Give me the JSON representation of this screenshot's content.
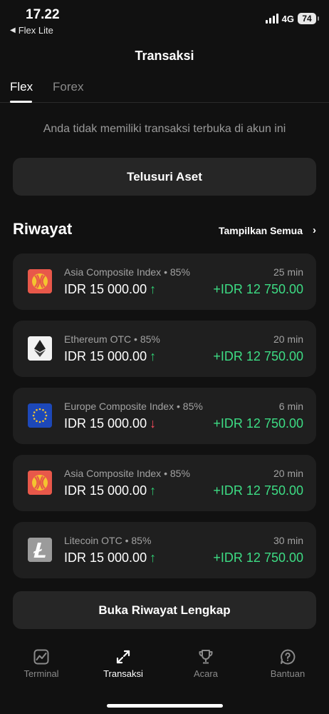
{
  "status_bar": {
    "time": "17.22",
    "back_app": "Flex Lite",
    "network": "4G",
    "battery": "74"
  },
  "header": {
    "title": "Transaksi"
  },
  "tabs": [
    {
      "label": "Flex",
      "active": true
    },
    {
      "label": "Forex",
      "active": false
    }
  ],
  "empty_message": "Anda tidak memiliki transaksi terbuka di akun ini",
  "browse_button": "Telusuri Aset",
  "history": {
    "title": "Riwayat",
    "show_all": "Tampilkan Semua",
    "items": [
      {
        "asset": "Asia Composite Index",
        "payout": "85%",
        "amount": "IDR 15 000.00",
        "direction": "up",
        "duration": "25 min",
        "profit": "+IDR 12 750.00",
        "icon": "asia-flag-icon"
      },
      {
        "asset": "Ethereum OTC",
        "payout": "85%",
        "amount": "IDR 15 000.00",
        "direction": "up",
        "duration": "20 min",
        "profit": "+IDR 12 750.00",
        "icon": "ethereum-icon"
      },
      {
        "asset": "Europe Composite Index",
        "payout": "85%",
        "amount": "IDR 15 000.00",
        "direction": "down",
        "duration": "6 min",
        "profit": "+IDR 12 750.00",
        "icon": "eu-flag-icon"
      },
      {
        "asset": "Asia Composite Index",
        "payout": "85%",
        "amount": "IDR 15 000.00",
        "direction": "up",
        "duration": "20 min",
        "profit": "+IDR 12 750.00",
        "icon": "asia-flag-icon"
      },
      {
        "asset": "Litecoin OTC",
        "payout": "85%",
        "amount": "IDR 15 000.00",
        "direction": "up",
        "duration": "30 min",
        "profit": "+IDR 12 750.00",
        "icon": "litecoin-icon"
      }
    ]
  },
  "full_history_button": "Buka Riwayat Lengkap",
  "bottom_nav": [
    {
      "label": "Terminal",
      "icon": "chart-icon",
      "active": false
    },
    {
      "label": "Transaksi",
      "icon": "transfer-arrows-icon",
      "active": true
    },
    {
      "label": "Acara",
      "icon": "trophy-icon",
      "active": false
    },
    {
      "label": "Bantuan",
      "icon": "help-icon",
      "active": false
    }
  ],
  "colors": {
    "background": "#111111",
    "card": "#1f1f1f",
    "profit_green": "#3ddc84",
    "up_arrow": "#2ecc71",
    "down_arrow": "#ff4d5e"
  }
}
